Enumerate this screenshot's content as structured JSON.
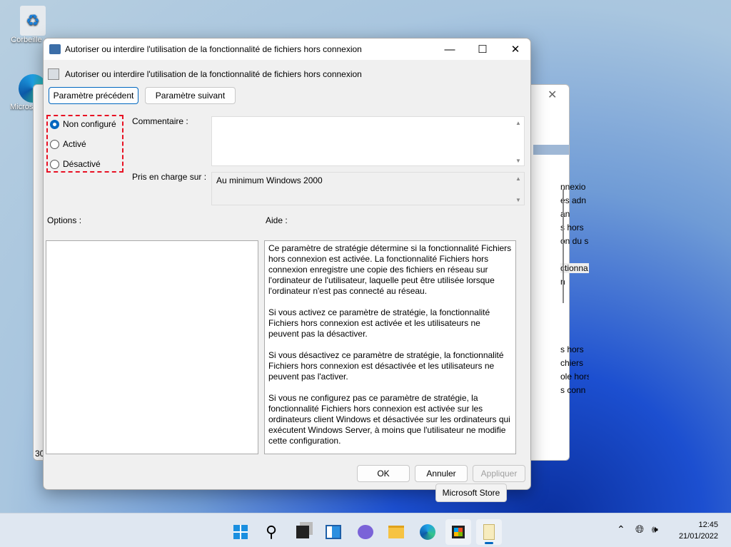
{
  "desktop": {
    "recycle_bin": "Corbeille",
    "edge": "Microsoft Edge"
  },
  "background_window": {
    "status": "30",
    "fragments": [
      "nnexio",
      "és adn",
      "an",
      "s hors",
      "on du s",
      "ctionna",
      "n",
      "s hors",
      "chiers",
      "ole hors",
      "s conn"
    ]
  },
  "dialog": {
    "title": "Autoriser ou interdire l'utilisation de la fonctionnalité de fichiers hors connexion",
    "policy_name": "Autoriser ou interdire l'utilisation de la fonctionnalité de fichiers hors connexion",
    "prev_button": "Paramètre précédent",
    "next_button": "Paramètre suivant",
    "radios": [
      {
        "label": "Non configuré",
        "checked": true
      },
      {
        "label": "Activé",
        "checked": false
      },
      {
        "label": "Désactivé",
        "checked": false
      }
    ],
    "comment_label": "Commentaire :",
    "comment_value": "",
    "supported_label": "Pris en charge sur :",
    "supported_value": "Au minimum Windows 2000",
    "options_label": "Options :",
    "help_label": "Aide :",
    "help_paragraphs": [
      "Ce paramètre de stratégie détermine si la fonctionnalité Fichiers hors connexion est activée. La fonctionnalité Fichiers hors connexion enregistre une copie des fichiers en réseau sur l'ordinateur de l'utilisateur, laquelle peut être utilisée lorsque l'ordinateur n'est pas connecté au réseau.",
      "Si vous activez ce paramètre de stratégie, la fonctionnalité Fichiers hors connexion est activée et les utilisateurs ne peuvent pas la désactiver.",
      "Si vous désactivez ce paramètre de stratégie, la fonctionnalité Fichiers hors connexion est désactivée et les utilisateurs ne peuvent pas l'activer.",
      "Si vous ne configurez pas ce paramètre de stratégie, la fonctionnalité Fichiers hors connexion est activée sur les ordinateurs client Windows et désactivée sur les ordinateurs qui exécutent Windows Server, à moins que l'utilisateur ne modifie cette configuration."
    ],
    "ok": "OK",
    "cancel": "Annuler",
    "apply": "Appliquer"
  },
  "tooltip": "Microsoft Store",
  "taskbar": {
    "time": "12:45",
    "date": "21/01/2022"
  },
  "colors": {
    "accent": "#0067c0",
    "highlight": "#e81123"
  }
}
